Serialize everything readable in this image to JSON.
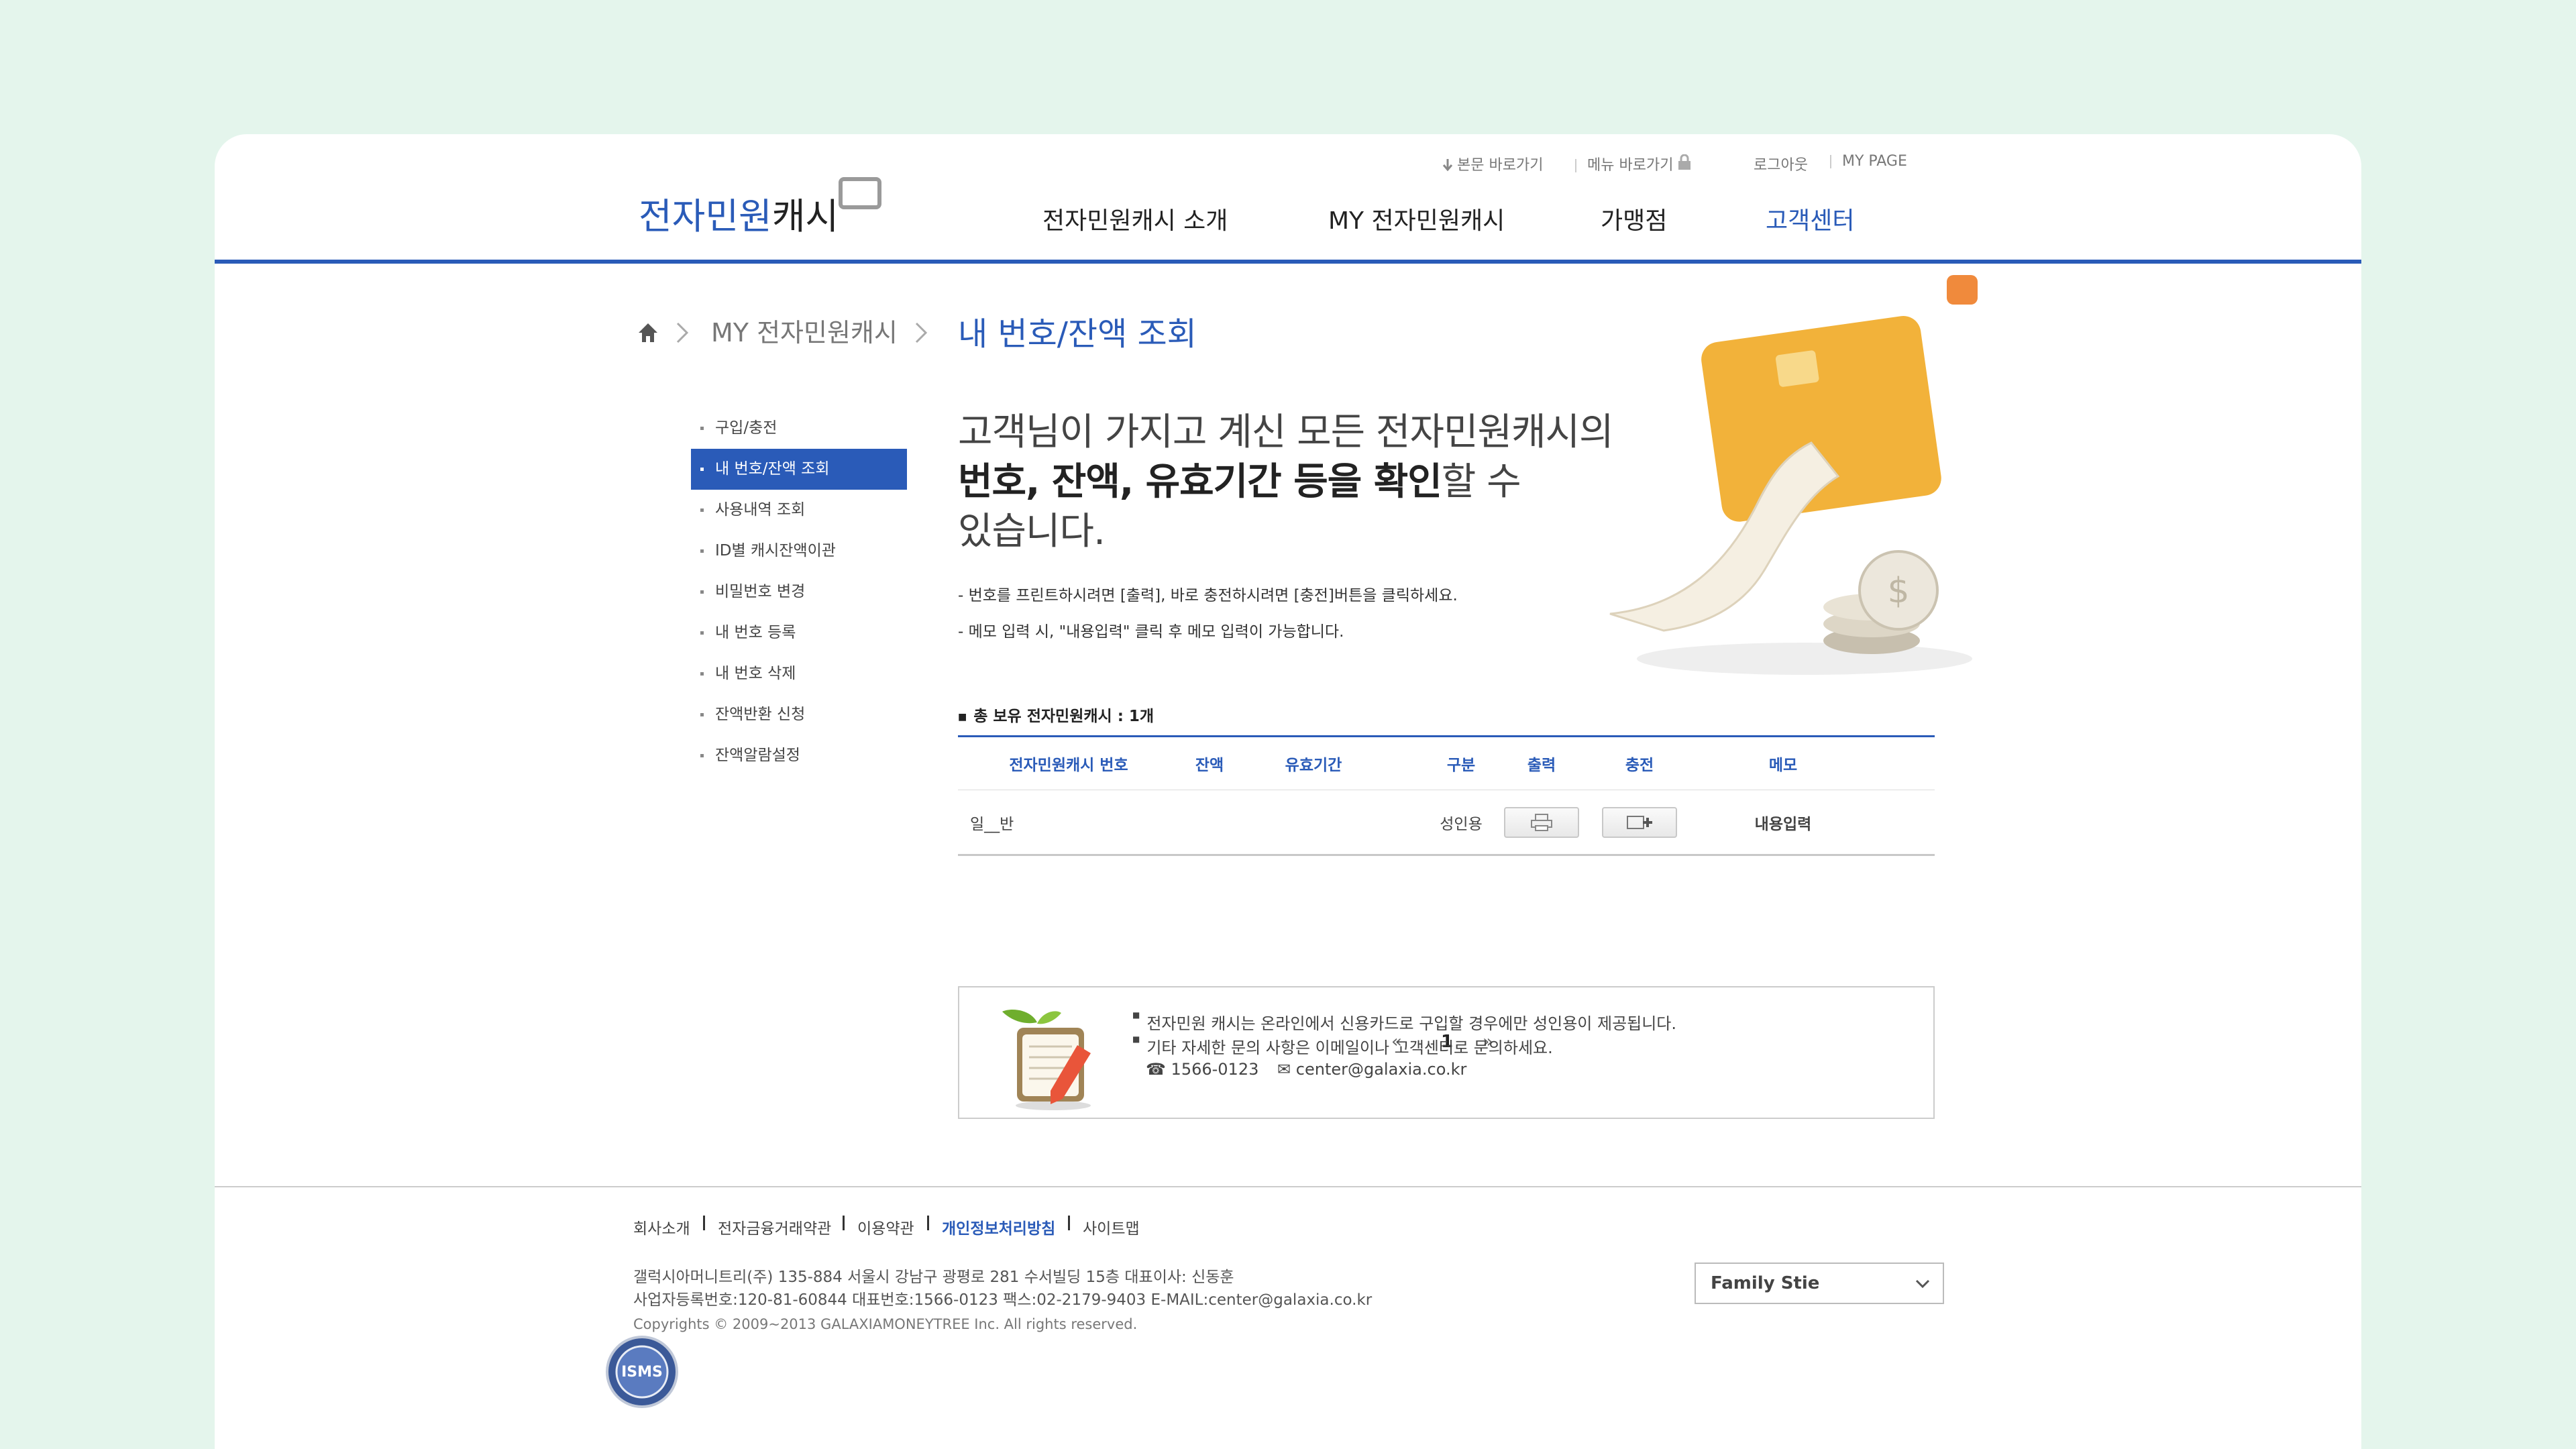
{
  "brand": {
    "part1": "전자민원",
    "part2": "캐시"
  },
  "util_links": {
    "skip_content": "본문 바로가기",
    "skip_menu": "메뉴 바로가기",
    "logout": "로그아웃",
    "mypage": "MY PAGE"
  },
  "gnb": [
    {
      "label": "전자민원캐시 소개"
    },
    {
      "label": "MY 전자민원캐시"
    },
    {
      "label": "가맹점"
    },
    {
      "label": "고객센터"
    }
  ],
  "breadcrumb": {
    "parent": "MY 전자민원캐시",
    "current": "내 번호/잔액 조회"
  },
  "lnb": [
    {
      "label": "구입/충전"
    },
    {
      "label": "내 번호/잔액 조회"
    },
    {
      "label": "사용내역 조회"
    },
    {
      "label": "ID별 캐시잔액이관"
    },
    {
      "label": "비밀번호 변경"
    },
    {
      "label": "내 번호 등록"
    },
    {
      "label": "내 번호 삭제"
    },
    {
      "label": "잔액반환 신청"
    },
    {
      "label": "잔액알람설정"
    }
  ],
  "intro": {
    "line1": "고객님이 가지고 계신 모든 전자민원캐시의",
    "line2_bold": "번호, 잔액, 유효기간 등을 확인",
    "line2_rest": "할 수",
    "line3": "있습니다."
  },
  "notes": [
    "- 번호를 프린트하시려면 [출력], 바로 충전하시려면 [충전]버튼을 클릭하세요.",
    "- 메모 입력 시, \"내용입력\" 클릭 후 메모 입력이 가능합니다."
  ],
  "table": {
    "caption": "총 보유 전자민원캐시 : 1개",
    "headers": [
      "전자민원캐시 번호",
      "잔액",
      "유효기간",
      "구분",
      "출력",
      "충전",
      "메모"
    ],
    "rows": [
      {
        "number": "일__반",
        "balance": "",
        "expiry": "",
        "type": "성인용",
        "memo": "내용입력"
      }
    ]
  },
  "pagination": {
    "prev": "«",
    "current": "1",
    "next": "»"
  },
  "info": {
    "line1": "전자민원 캐시는 온라인에서 신용카드로 구입할 경우에만 성인용이 제공됩니다.",
    "line2": "기타 자세한 문의 사항은 이메일이나 고객센터로 문의하세요.",
    "phone": "1566-0123",
    "email": "center@galaxia.co.kr"
  },
  "footer": {
    "links": [
      {
        "label": "회사소개"
      },
      {
        "label": "전자금융거래약관"
      },
      {
        "label": "이용약관"
      },
      {
        "label": "개인정보처리방침"
      },
      {
        "label": "사이트맵"
      }
    ],
    "address": "갤럭시아머니트리(주) 135-884 서울시 강남구 광평로 281 수서빌딩 15층    대표이사: 신동훈",
    "business": "사업자등록번호:120-81-60844    대표번호:1566-0123    팩스:02-2179-9403    E-MAIL:center@galaxia.co.kr",
    "copyright": "Copyrights © 2009~2013 GALAXIAMONEYTREE Inc. All rights reserved.",
    "family_site": "Family Stie",
    "isms_badge": "ISMS"
  },
  "colors": {
    "brand_blue": "#2a5bb8",
    "background": "#e4f5ec",
    "orange": "#f08a3c",
    "card_gold": "#f2b23a"
  }
}
